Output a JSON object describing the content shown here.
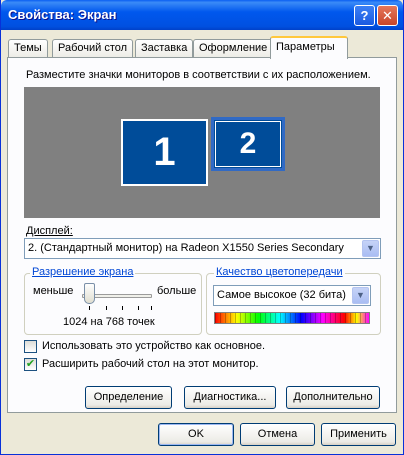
{
  "window": {
    "title": "Свойства: Экран"
  },
  "titlebar": {
    "help_label": "?",
    "close_label": "✕"
  },
  "tabs": [
    {
      "label": "Темы"
    },
    {
      "label": "Рабочий стол"
    },
    {
      "label": "Заставка"
    },
    {
      "label": "Оформление"
    },
    {
      "label": "Параметры",
      "active": true
    }
  ],
  "settings": {
    "intro_text": "Разместите значки мониторов в соответствии с их расположением.",
    "monitors": [
      {
        "label": "1"
      },
      {
        "label": "2",
        "selected": true
      }
    ],
    "display_label": "Дисплей:",
    "display_value": "2. (Стандартный монитор) на Radeon X1550 Series Secondary",
    "resolution": {
      "title": "Разрешение экрана",
      "less_label": "меньше",
      "more_label": "больше",
      "value_text": "1024 на 768 точек",
      "slider_level": 0.1
    },
    "color_quality": {
      "title": "Качество цветопередачи",
      "value": "Самое высокое (32 бита)"
    },
    "primary_checkbox": {
      "label": "Использовать это устройство как основное.",
      "checked": false
    },
    "extend_checkbox": {
      "label": "Расширить рабочий стол на этот монитор.",
      "checked": true
    },
    "identify_button": "Определение",
    "troubleshoot_button": "Диагностика...",
    "advanced_button": "Дополнительно"
  },
  "footer": {
    "ok": "OK",
    "cancel": "Отмена",
    "apply": "Применить"
  }
}
